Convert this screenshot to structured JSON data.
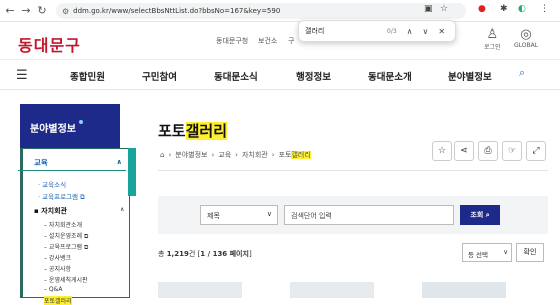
{
  "browser": {
    "url": "ddm.go.kr/www/selectBbsNttList.do?bbsNo=167&key=590",
    "find_query": "갤러리",
    "find_count": "0/3"
  },
  "header": {
    "logo": "동대문구",
    "util_links": [
      "동대문구청",
      "보건소",
      "구"
    ],
    "login_label": "로그인",
    "global_label": "GLOBAL"
  },
  "gnb": [
    "종합민원",
    "구민참여",
    "동대문소식",
    "행정정보",
    "동대문소개",
    "분야별정보"
  ],
  "side": {
    "title": "분야별정보",
    "section": "교육",
    "items": [
      "교육소식",
      "교육프로그램"
    ],
    "sub_section": "자치회관",
    "sub_items": [
      "자치회관소개",
      "설치운영조례",
      "교육프로그램",
      "강사뱅크",
      "공지사항",
      "운영세칙게시판",
      "Q&A",
      "포토갤러리"
    ]
  },
  "page": {
    "title_pre": "포토",
    "title_hl": "갤러리",
    "breadcrumb": [
      "분야별정보",
      "교육",
      "자치회관",
      "포토"
    ],
    "breadcrumb_hl": "갤러리"
  },
  "search": {
    "select": "제목",
    "placeholder": "검색단어 입력",
    "button": "조회"
  },
  "list": {
    "total_label": "총",
    "total": "1,219",
    "total_unit": "건",
    "page_info": "1 / 136 페이지",
    "per_page": "등 선택",
    "confirm": "확인"
  }
}
